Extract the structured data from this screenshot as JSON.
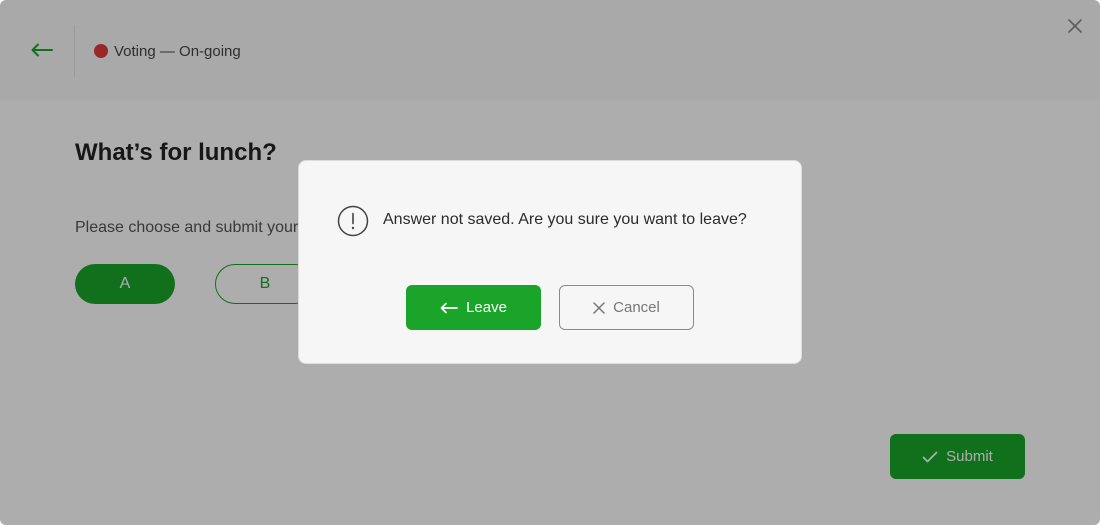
{
  "header": {
    "back_icon": "arrow-left-icon",
    "status_label": "Voting — On-going",
    "status_color": "#e33b3b",
    "close_icon": "close-icon"
  },
  "poll": {
    "title": "What’s for lunch?",
    "instruction": "Please choose and submit your answer.",
    "options": [
      {
        "label": "A",
        "selected": true
      },
      {
        "label": "B",
        "selected": false
      }
    ]
  },
  "submit": {
    "label": "Submit",
    "icon": "check-icon"
  },
  "dialog": {
    "icon": "warning-circle-icon",
    "message": "Answer not saved. Are you sure you want to leave?",
    "leave_label": "Leave",
    "leave_icon": "arrow-left-icon",
    "cancel_label": "Cancel",
    "cancel_icon": "close-icon"
  },
  "colors": {
    "accent": "#1aa52a",
    "status_ongoing": "#e33b3b",
    "overlay": "rgba(0,0,0,0.32)"
  }
}
